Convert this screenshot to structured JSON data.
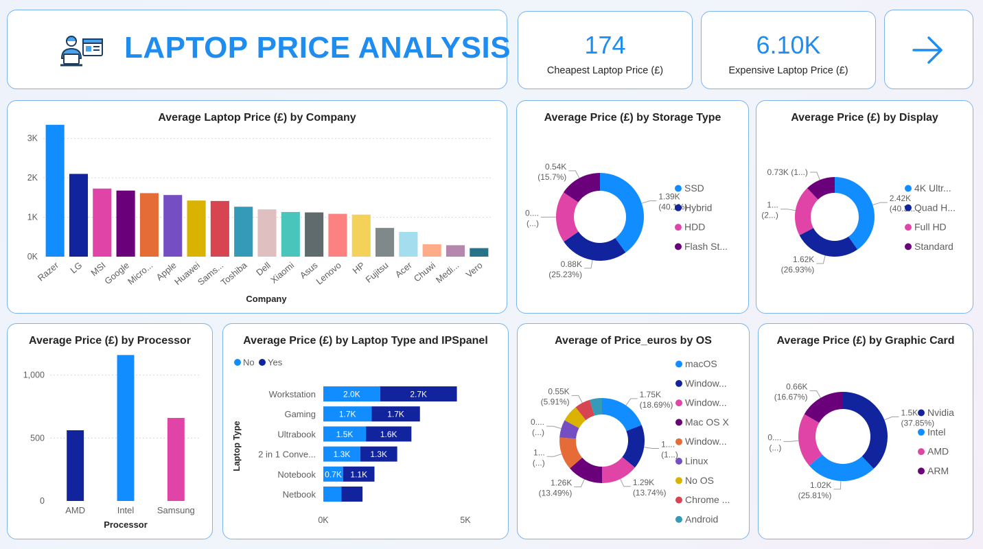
{
  "header": {
    "title": "LAPTOP PRICE ANALYSIS",
    "icon": "laptop-analyst-icon"
  },
  "kpis": [
    {
      "value": "174",
      "label": "Cheapest Laptop Price (£)"
    },
    {
      "value": "6.10K",
      "label": "Expensive Laptop Price (£)"
    }
  ],
  "nav": {
    "icon": "arrow-right-icon"
  },
  "colors": {
    "accent": "#1f8cf0",
    "border": "#7ab3ee"
  },
  "chart_data": [
    {
      "id": "company",
      "type": "bar",
      "title": "Average Laptop Price (£) by Company",
      "xlabel": "Company",
      "ylabel": "",
      "ylim": [
        0,
        3500
      ],
      "yticks": [
        0,
        1000,
        2000,
        3000
      ],
      "ytick_labels": [
        "0K",
        "1K",
        "2K",
        "3K"
      ],
      "categories": [
        "Razer",
        "LG",
        "MSI",
        "Google",
        "Micro...",
        "Apple",
        "Huawei",
        "Sams...",
        "Toshiba",
        "Dell",
        "Xiaomi",
        "Asus",
        "Lenovo",
        "HP",
        "Fujitsu",
        "Acer",
        "Chuwi",
        "Medi...",
        "Vero"
      ],
      "values": [
        3346,
        2100,
        1728,
        1677,
        1612,
        1564,
        1424,
        1413,
        1267,
        1199,
        1133,
        1123,
        1087,
        1067,
        729,
        627,
        315,
        290,
        217
      ],
      "colors": [
        "#118dff",
        "#12239e",
        "#e044a7",
        "#6b007b",
        "#e66c37",
        "#744ec2",
        "#d9b300",
        "#d64550",
        "#3599b8",
        "#dfbfbf",
        "#4ac5bb",
        "#5f6b6d",
        "#fb8281",
        "#f4d25a",
        "#7f898a",
        "#a4ddee",
        "#fdab89",
        "#b687ac",
        "#28738a"
      ]
    },
    {
      "id": "storage",
      "type": "pie",
      "title": "Average Price (£) by Storage Type",
      "categories": [
        "SSD",
        "Hybrid",
        "HDD",
        "Flash St..."
      ],
      "values": [
        1.39,
        0.88,
        0.66,
        0.54
      ],
      "percents": [
        40.1,
        25.23,
        18.97,
        15.7
      ],
      "colors": [
        "#118dff",
        "#12239e",
        "#e044a7",
        "#6b007b"
      ],
      "labels": [
        [
          "1.39K",
          "(40.1%)"
        ],
        [
          "0.88K",
          "(25.23%)"
        ],
        [
          "0....",
          "(...)"
        ],
        [
          "0.54K",
          "(15.7%)"
        ]
      ]
    },
    {
      "id": "display",
      "type": "pie",
      "title": "Average Price (£) by Display",
      "categories": [
        "4K Ultr...",
        "Quad H...",
        "Full HD",
        "Standard"
      ],
      "values": [
        2.42,
        1.62,
        1.23,
        0.73
      ],
      "percents": [
        40.3,
        26.93,
        20.6,
        12.17
      ],
      "colors": [
        "#118dff",
        "#12239e",
        "#e044a7",
        "#6b007b"
      ],
      "labels": [
        [
          "2.42K",
          "(40.3..."
        ],
        [
          "1.62K",
          "(26.93%)"
        ],
        [
          "1...",
          "(2...)"
        ],
        [
          "0.73K (1...)",
          ""
        ]
      ]
    },
    {
      "id": "processor",
      "type": "bar",
      "title": "Average Price (£) by Processor",
      "xlabel": "Processor",
      "ylabel": "",
      "ylim": [
        0,
        1200
      ],
      "yticks": [
        0,
        500,
        1000
      ],
      "ytick_labels": [
        "0",
        "500",
        "1,000"
      ],
      "categories": [
        "AMD",
        "Intel",
        "Samsung"
      ],
      "values": [
        562,
        1160,
        660
      ],
      "colors": [
        "#12239e",
        "#118dff",
        "#e044a7"
      ]
    },
    {
      "id": "laptop_type",
      "type": "bar",
      "orientation": "horizontal",
      "stacked": true,
      "title": "Average Price (£) by Laptop Type and IPSpanel",
      "ylabel": "Laptop Type",
      "xlabel": "",
      "xlim": [
        0,
        5000
      ],
      "xtick_labels": [
        "0K",
        "5K"
      ],
      "legend": "top-left",
      "categories": [
        "Workstation",
        "Gaming",
        "Ultrabook",
        "2 in 1 Conve...",
        "Notebook",
        "Netbook"
      ],
      "series": [
        {
          "name": "No",
          "color": "#118dff",
          "values": [
            2000,
            1700,
            1500,
            1300,
            700,
            640
          ],
          "labels": [
            "2.0K",
            "1.7K",
            "1.5K",
            "1.3K",
            "0.7K",
            ""
          ]
        },
        {
          "name": "Yes",
          "color": "#12239e",
          "values": [
            2700,
            1700,
            1600,
            1300,
            1100,
            740
          ],
          "labels": [
            "2.7K",
            "1.7K",
            "1.6K",
            "1.3K",
            "1.1K",
            ""
          ]
        }
      ]
    },
    {
      "id": "os",
      "type": "pie",
      "title": "Average of Price_euros by OS",
      "categories": [
        "macOS",
        "Window...",
        "Window...",
        "Mac OS X",
        "Window...",
        "Linux",
        "No OS",
        "Chrome ...",
        "Android"
      ],
      "values": [
        1.75,
        1.55,
        1.29,
        1.26,
        1.15,
        0.62,
        0.59,
        0.55,
        0.43
      ],
      "percents": [
        18.69,
        16.56,
        13.74,
        13.49,
        12.28,
        6.63,
        6.26,
        5.91,
        4.44
      ],
      "colors": [
        "#118dff",
        "#12239e",
        "#e044a7",
        "#6b007b",
        "#e66c37",
        "#744ec2",
        "#d9b300",
        "#d64550",
        "#3599b8"
      ],
      "labels": [
        [
          "1.75K",
          "(18.69%)"
        ],
        [
          "1....",
          "(1...)"
        ],
        [
          "1.29K",
          "(13.74%)"
        ],
        [
          "1.26K",
          "(13.49%)"
        ],
        [
          "1...",
          "(...)"
        ],
        [
          "0....",
          "(...)"
        ],
        [
          "",
          ""
        ],
        [
          "0.55K",
          "(5.91%)"
        ],
        [
          "",
          ""
        ]
      ]
    },
    {
      "id": "graphic",
      "type": "pie",
      "title": "Average Price (£) by Graphic Card",
      "categories": [
        "Nvidia",
        "Intel",
        "AMD",
        "ARM"
      ],
      "values": [
        1.5,
        1.02,
        0.78,
        0.66
      ],
      "percents": [
        37.85,
        25.81,
        19.67,
        16.67
      ],
      "colors": [
        "#12239e",
        "#118dff",
        "#e044a7",
        "#6b007b"
      ],
      "labels": [
        [
          "1.5K",
          "(37.85%)"
        ],
        [
          "1.02K",
          "(25.81%)"
        ],
        [
          "0....",
          "(...)"
        ],
        [
          "0.66K",
          "(16.67%)"
        ]
      ]
    }
  ]
}
